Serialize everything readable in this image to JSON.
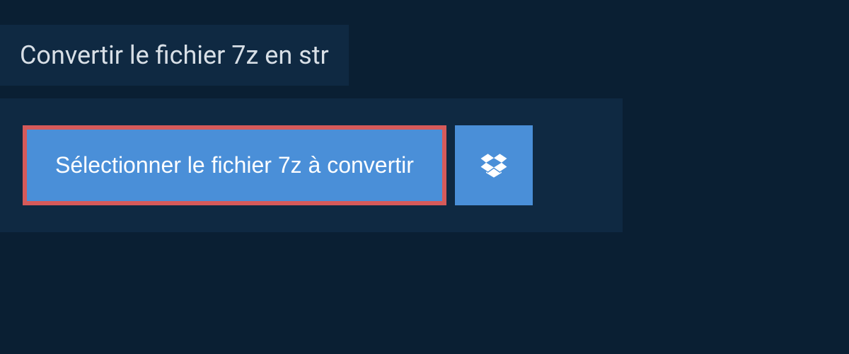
{
  "header": {
    "title": "Convertir le fichier 7z en str"
  },
  "main": {
    "select_button_label": "Sélectionner le fichier 7z à convertir"
  }
}
